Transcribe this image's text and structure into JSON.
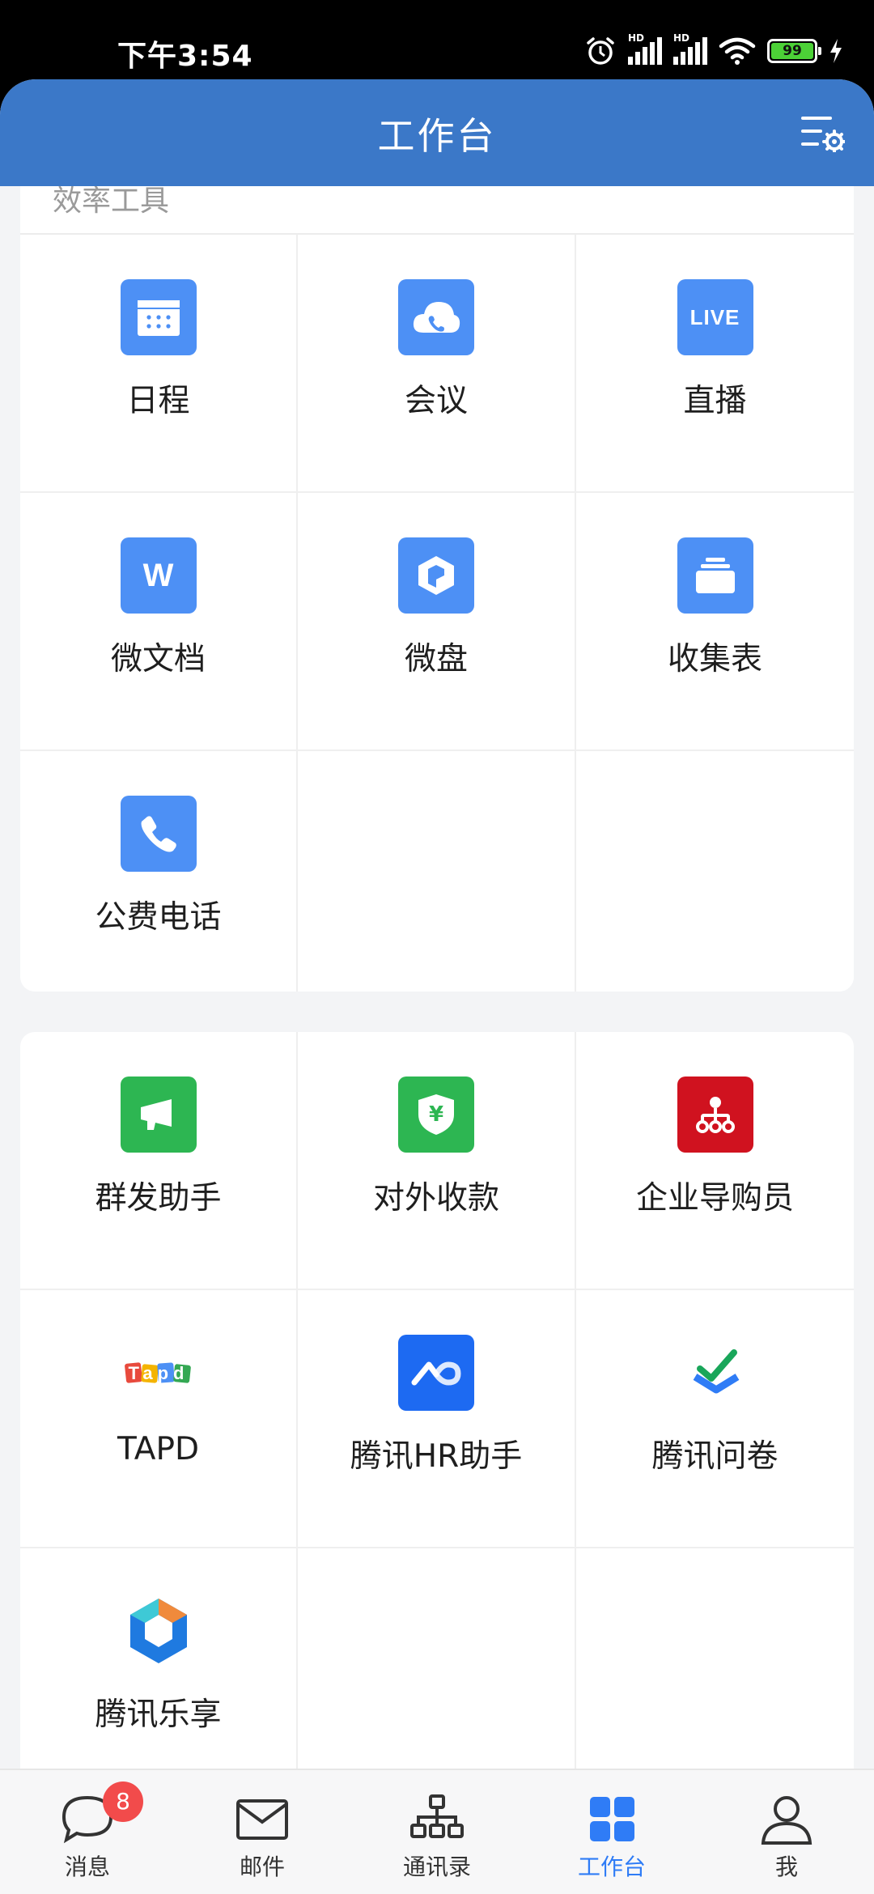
{
  "status_bar": {
    "time": "下午3:54",
    "battery": "99",
    "signal_hd_1": "HD",
    "signal_hd_2": "HD"
  },
  "header": {
    "title": "工作台"
  },
  "section_efficiency": {
    "title": "效率工具",
    "apps": [
      {
        "label": "日程",
        "icon": "calendar-icon"
      },
      {
        "label": "会议",
        "icon": "cloud-phone-icon"
      },
      {
        "label": "直播",
        "icon": "live-icon",
        "icon_text": "LIVE"
      },
      {
        "label": "微文档",
        "icon": "doc-icon",
        "icon_text": "W"
      },
      {
        "label": "微盘",
        "icon": "drive-icon"
      },
      {
        "label": "收集表",
        "icon": "form-icon"
      },
      {
        "label": "公费电话",
        "icon": "phone-icon"
      }
    ]
  },
  "section_more": {
    "apps": [
      {
        "label": "群发助手",
        "icon": "megaphone-icon"
      },
      {
        "label": "对外收款",
        "icon": "payment-shield-icon",
        "icon_text": "¥"
      },
      {
        "label": "企业导购员",
        "icon": "org-chart-icon"
      },
      {
        "label": "TAPD",
        "icon": "tapd-logo",
        "icon_text": "Tapd"
      },
      {
        "label": "腾讯HR助手",
        "icon": "hr-assistant-icon"
      },
      {
        "label": "腾讯问卷",
        "icon": "checkmark-survey-icon"
      },
      {
        "label": "腾讯乐享",
        "icon": "hexagon-logo-icon"
      }
    ]
  },
  "tabbar": {
    "items": [
      {
        "label": "消息",
        "icon": "chat-bubble-icon",
        "badge": "8"
      },
      {
        "label": "邮件",
        "icon": "mail-icon"
      },
      {
        "label": "通讯录",
        "icon": "contacts-tree-icon"
      },
      {
        "label": "工作台",
        "icon": "grid-icon",
        "active": true
      },
      {
        "label": "我",
        "icon": "person-icon"
      }
    ]
  },
  "colors": {
    "header": "#3b78c8",
    "accent": "#2f7cf6",
    "app_blue": "#4d90f5",
    "app_green": "#2db652",
    "app_red": "#d0121f",
    "badge": "#f24b4b"
  }
}
